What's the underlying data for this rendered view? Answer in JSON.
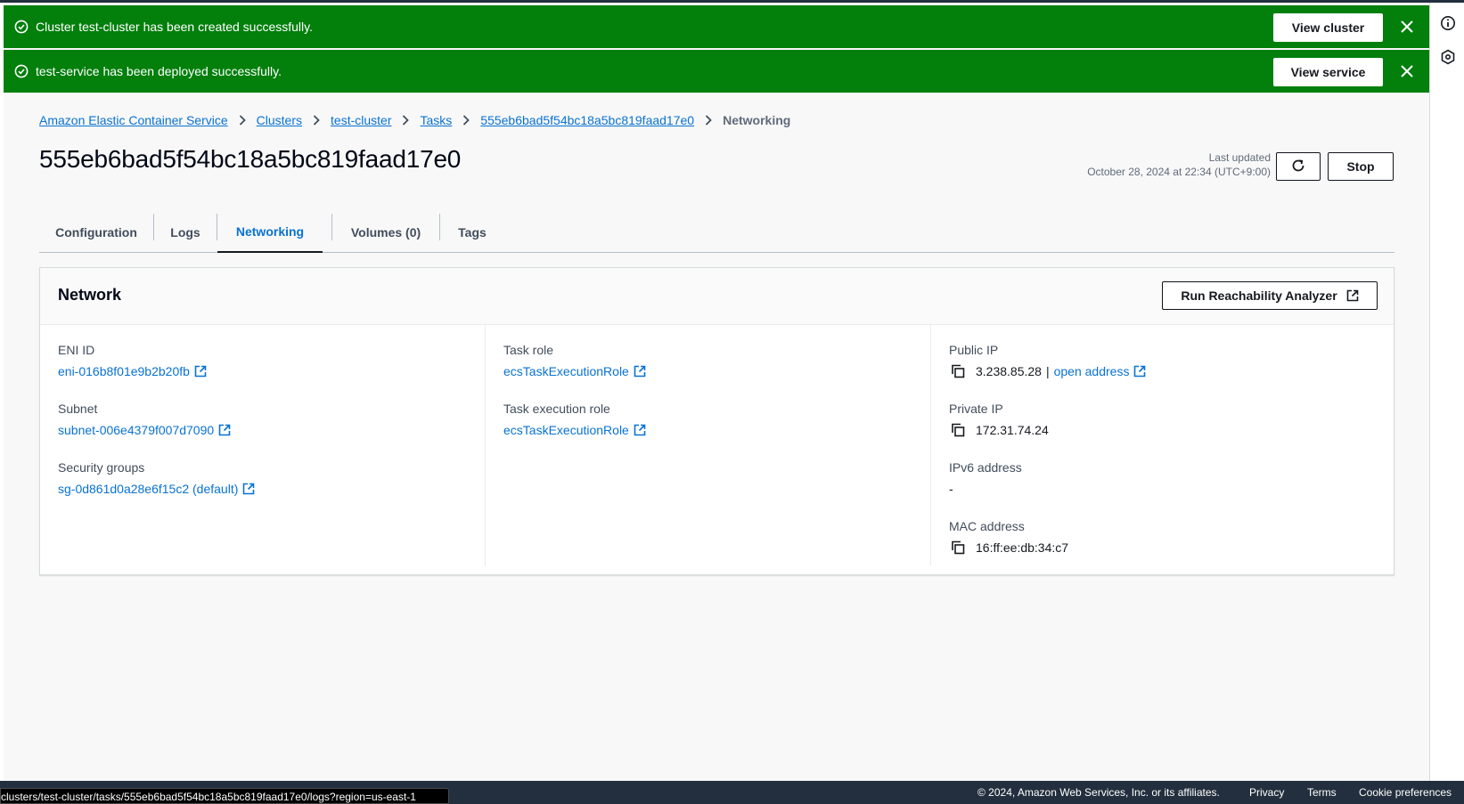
{
  "flash": [
    {
      "message": "Cluster test-cluster has been created successfully.",
      "action": "View cluster"
    },
    {
      "message": "test-service has been deployed successfully.",
      "action": "View service"
    }
  ],
  "breadcrumbs": [
    "Amazon Elastic Container Service",
    "Clusters",
    "test-cluster",
    "Tasks",
    "555eb6bad5f54bc18a5bc819faad17e0",
    "Networking"
  ],
  "page": {
    "title": "555eb6bad5f54bc18a5bc819faad17e0",
    "last_updated_label": "Last updated",
    "last_updated_value": "October 28, 2024 at 22:34 (UTC+9:00)",
    "stop_label": "Stop"
  },
  "tabs": [
    {
      "label": "Configuration"
    },
    {
      "label": "Logs"
    },
    {
      "label": "Networking",
      "active": true
    },
    {
      "label": "Volumes (0)"
    },
    {
      "label": "Tags"
    }
  ],
  "network": {
    "title": "Network",
    "analyzer_label": "Run Reachability Analyzer",
    "eni_label": "ENI ID",
    "eni_value": "eni-016b8f01e9b2b20fb",
    "subnet_label": "Subnet",
    "subnet_value": "subnet-006e4379f007d7090",
    "sg_label": "Security groups",
    "sg_value": "sg-0d861d0a28e6f15c2 (default)",
    "task_role_label": "Task role",
    "task_role_value": "ecsTaskExecutionRole",
    "exec_role_label": "Task execution role",
    "exec_role_value": "ecsTaskExecutionRole",
    "public_ip_label": "Public IP",
    "public_ip_value": "3.238.85.28",
    "public_ip_sep": "|",
    "open_address": "open address",
    "private_ip_label": "Private IP",
    "private_ip_value": "172.31.74.24",
    "ipv6_label": "IPv6 address",
    "ipv6_value": "-",
    "mac_label": "MAC address",
    "mac_value": "16:ff:ee:db:34:c7"
  },
  "footer": {
    "copyright": "© 2024, Amazon Web Services, Inc. or its affiliates.",
    "privacy": "Privacy",
    "terms": "Terms",
    "cookies": "Cookie preferences"
  },
  "status_url": "clusters/test-cluster/tasks/555eb6bad5f54bc18a5bc819faad17e0/logs?region=us-east-1",
  "colors": {
    "success": "#037f0c",
    "link": "#0972d3",
    "footer": "#232f3e"
  }
}
